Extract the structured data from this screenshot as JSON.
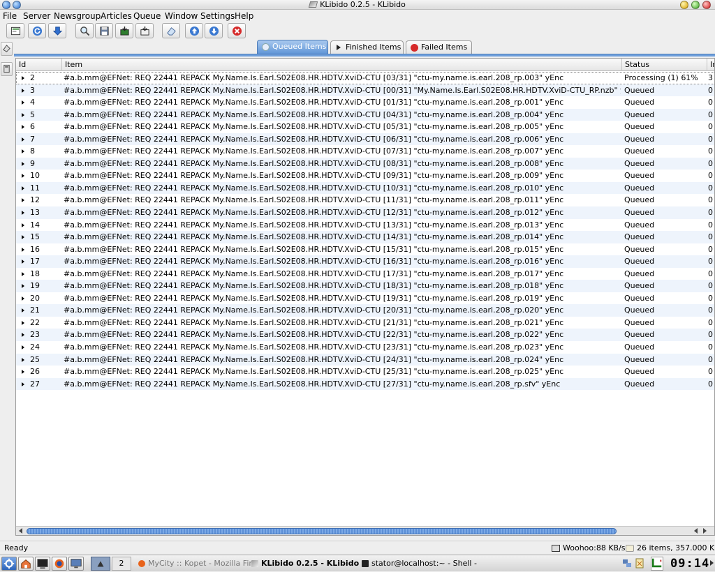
{
  "window": {
    "title": "KLibido 0.2.5 - KLibido"
  },
  "menu": [
    "File",
    "Server",
    "Newsgroup",
    "Articles",
    "Queue",
    "Window",
    "Settings",
    "Help"
  ],
  "tabs": [
    {
      "label": "Queued Items",
      "active": true
    },
    {
      "label": "Finished Items",
      "active": false
    },
    {
      "label": "Failed Items",
      "active": false
    }
  ],
  "columns": {
    "id": "Id",
    "item": "Item",
    "status": "Status",
    "extra": "Ir"
  },
  "rows": [
    {
      "id": "2",
      "item": "#a.b.mm@EFNet: REQ 22441 REPACK My.Name.Is.Earl.S02E08.HR.HDTV.XviD-CTU [03/31] \"ctu-my.name.is.earl.208_rp.003\" yEnc",
      "status": "Processing (1) 61%",
      "extra": "3"
    },
    {
      "id": "3",
      "item": "#a.b.mm@EFNet: REQ 22441 REPACK My.Name.Is.Earl.S02E08.HR.HDTV.XviD-CTU [00/31] \"My.Name.Is.Earl.S02E08.HR.HDTV.XviD-CTU_RP.nzb\" yEnc",
      "status": "Queued",
      "extra": "0"
    },
    {
      "id": "4",
      "item": "#a.b.mm@EFNet: REQ 22441 REPACK My.Name.Is.Earl.S02E08.HR.HDTV.XviD-CTU [01/31] \"ctu-my.name.is.earl.208_rp.001\" yEnc",
      "status": "Queued",
      "extra": "0"
    },
    {
      "id": "5",
      "item": "#a.b.mm@EFNet: REQ 22441 REPACK My.Name.Is.Earl.S02E08.HR.HDTV.XviD-CTU [04/31] \"ctu-my.name.is.earl.208_rp.004\" yEnc",
      "status": "Queued",
      "extra": "0"
    },
    {
      "id": "6",
      "item": "#a.b.mm@EFNet: REQ 22441 REPACK My.Name.Is.Earl.S02E08.HR.HDTV.XviD-CTU [05/31] \"ctu-my.name.is.earl.208_rp.005\" yEnc",
      "status": "Queued",
      "extra": "0"
    },
    {
      "id": "7",
      "item": "#a.b.mm@EFNet: REQ 22441 REPACK My.Name.Is.Earl.S02E08.HR.HDTV.XviD-CTU [06/31] \"ctu-my.name.is.earl.208_rp.006\" yEnc",
      "status": "Queued",
      "extra": "0"
    },
    {
      "id": "8",
      "item": "#a.b.mm@EFNet: REQ 22441 REPACK My.Name.Is.Earl.S02E08.HR.HDTV.XviD-CTU [07/31] \"ctu-my.name.is.earl.208_rp.007\" yEnc",
      "status": "Queued",
      "extra": "0"
    },
    {
      "id": "9",
      "item": "#a.b.mm@EFNet: REQ 22441 REPACK My.Name.Is.Earl.S02E08.HR.HDTV.XviD-CTU [08/31] \"ctu-my.name.is.earl.208_rp.008\" yEnc",
      "status": "Queued",
      "extra": "0"
    },
    {
      "id": "10",
      "item": "#a.b.mm@EFNet: REQ 22441 REPACK My.Name.Is.Earl.S02E08.HR.HDTV.XviD-CTU [09/31] \"ctu-my.name.is.earl.208_rp.009\" yEnc",
      "status": "Queued",
      "extra": "0"
    },
    {
      "id": "11",
      "item": "#a.b.mm@EFNet: REQ 22441 REPACK My.Name.Is.Earl.S02E08.HR.HDTV.XviD-CTU [10/31] \"ctu-my.name.is.earl.208_rp.010\" yEnc",
      "status": "Queued",
      "extra": "0"
    },
    {
      "id": "12",
      "item": "#a.b.mm@EFNet: REQ 22441 REPACK My.Name.Is.Earl.S02E08.HR.HDTV.XviD-CTU [11/31] \"ctu-my.name.is.earl.208_rp.011\" yEnc",
      "status": "Queued",
      "extra": "0"
    },
    {
      "id": "13",
      "item": "#a.b.mm@EFNet: REQ 22441 REPACK My.Name.Is.Earl.S02E08.HR.HDTV.XviD-CTU [12/31] \"ctu-my.name.is.earl.208_rp.012\" yEnc",
      "status": "Queued",
      "extra": "0"
    },
    {
      "id": "14",
      "item": "#a.b.mm@EFNet: REQ 22441 REPACK My.Name.Is.Earl.S02E08.HR.HDTV.XviD-CTU [13/31] \"ctu-my.name.is.earl.208_rp.013\" yEnc",
      "status": "Queued",
      "extra": "0"
    },
    {
      "id": "15",
      "item": "#a.b.mm@EFNet: REQ 22441 REPACK My.Name.Is.Earl.S02E08.HR.HDTV.XviD-CTU [14/31] \"ctu-my.name.is.earl.208_rp.014\" yEnc",
      "status": "Queued",
      "extra": "0"
    },
    {
      "id": "16",
      "item": "#a.b.mm@EFNet: REQ 22441 REPACK My.Name.Is.Earl.S02E08.HR.HDTV.XviD-CTU [15/31] \"ctu-my.name.is.earl.208_rp.015\" yEnc",
      "status": "Queued",
      "extra": "0"
    },
    {
      "id": "17",
      "item": "#a.b.mm@EFNet: REQ 22441 REPACK My.Name.Is.Earl.S02E08.HR.HDTV.XviD-CTU [16/31] \"ctu-my.name.is.earl.208_rp.016\" yEnc",
      "status": "Queued",
      "extra": "0"
    },
    {
      "id": "18",
      "item": "#a.b.mm@EFNet: REQ 22441 REPACK My.Name.Is.Earl.S02E08.HR.HDTV.XviD-CTU [17/31] \"ctu-my.name.is.earl.208_rp.017\" yEnc",
      "status": "Queued",
      "extra": "0"
    },
    {
      "id": "19",
      "item": "#a.b.mm@EFNet: REQ 22441 REPACK My.Name.Is.Earl.S02E08.HR.HDTV.XviD-CTU [18/31] \"ctu-my.name.is.earl.208_rp.018\" yEnc",
      "status": "Queued",
      "extra": "0"
    },
    {
      "id": "20",
      "item": "#a.b.mm@EFNet: REQ 22441 REPACK My.Name.Is.Earl.S02E08.HR.HDTV.XviD-CTU [19/31] \"ctu-my.name.is.earl.208_rp.019\" yEnc",
      "status": "Queued",
      "extra": "0"
    },
    {
      "id": "21",
      "item": "#a.b.mm@EFNet: REQ 22441 REPACK My.Name.Is.Earl.S02E08.HR.HDTV.XviD-CTU [20/31] \"ctu-my.name.is.earl.208_rp.020\" yEnc",
      "status": "Queued",
      "extra": "0"
    },
    {
      "id": "22",
      "item": "#a.b.mm@EFNet: REQ 22441 REPACK My.Name.Is.Earl.S02E08.HR.HDTV.XviD-CTU [21/31] \"ctu-my.name.is.earl.208_rp.021\" yEnc",
      "status": "Queued",
      "extra": "0"
    },
    {
      "id": "23",
      "item": "#a.b.mm@EFNet: REQ 22441 REPACK My.Name.Is.Earl.S02E08.HR.HDTV.XviD-CTU [22/31] \"ctu-my.name.is.earl.208_rp.022\" yEnc",
      "status": "Queued",
      "extra": "0"
    },
    {
      "id": "24",
      "item": "#a.b.mm@EFNet: REQ 22441 REPACK My.Name.Is.Earl.S02E08.HR.HDTV.XviD-CTU [23/31] \"ctu-my.name.is.earl.208_rp.023\" yEnc",
      "status": "Queued",
      "extra": "0"
    },
    {
      "id": "25",
      "item": "#a.b.mm@EFNet: REQ 22441 REPACK My.Name.Is.Earl.S02E08.HR.HDTV.XviD-CTU [24/31] \"ctu-my.name.is.earl.208_rp.024\" yEnc",
      "status": "Queued",
      "extra": "0"
    },
    {
      "id": "26",
      "item": "#a.b.mm@EFNet: REQ 22441 REPACK My.Name.Is.Earl.S02E08.HR.HDTV.XviD-CTU [25/31] \"ctu-my.name.is.earl.208_rp.025\" yEnc",
      "status": "Queued",
      "extra": "0"
    },
    {
      "id": "27",
      "item": "#a.b.mm@EFNet: REQ 22441 REPACK My.Name.Is.Earl.S02E08.HR.HDTV.XviD-CTU [27/31] \"ctu-my.name.is.earl.208_rp.sfv\" yEnc",
      "status": "Queued",
      "extra": "0"
    }
  ],
  "statusbar": {
    "left": "Ready",
    "speed": "Woohoo:88 KB/s",
    "items": "26 items, 357.000 KB"
  },
  "taskbar": {
    "desktop_number": "2",
    "tasks": [
      "MyCity :: Kopet - Mozilla Fir",
      "KLibido 0.2.5 - KLibido",
      "stator@localhost:~ - Shell -"
    ],
    "clock": "09:14"
  },
  "colors": {
    "accent": "#5d93d6",
    "alt_row": "#eef4fc",
    "close_red": "#d62a2a"
  }
}
